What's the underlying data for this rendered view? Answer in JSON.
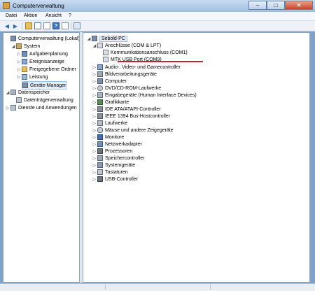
{
  "window": {
    "title": "Computerverwaltung",
    "controls": {
      "minimize": "–",
      "maximize": "□",
      "close": "✕"
    }
  },
  "menu": [
    "Datei",
    "Aktion",
    "Ansicht",
    "?"
  ],
  "left_tree": [
    {
      "label": "Computerverwaltung (Lokal)",
      "icon": "computer-management-icon"
    },
    {
      "label": "System",
      "icon": "system-tools-icon"
    },
    {
      "label": "Aufgabenplanung",
      "icon": "task-scheduler-icon"
    },
    {
      "label": "Ereignisanzeige",
      "icon": "event-viewer-icon"
    },
    {
      "label": "Freigegebene Ordner",
      "icon": "shared-folder-icon"
    },
    {
      "label": "Leistung",
      "icon": "performance-icon"
    },
    {
      "label": "Geräte-Manager",
      "icon": "device-manager-icon"
    },
    {
      "label": "Datenspeicher",
      "icon": "storage-icon"
    },
    {
      "label": "Datenträgerverwaltung",
      "icon": "disk-management-icon"
    },
    {
      "label": "Dienste und Anwendungen",
      "icon": "services-icon"
    }
  ],
  "device_tree": {
    "root": "Sebold-PC",
    "ports_group": "Anschlüsse (COM & LPT)",
    "ports": [
      "Kommunikationsanschluss (COM1)",
      "MTK USB Port (COM9)"
    ],
    "categories": [
      "Audio-, Video- und Gamecontroller",
      "Bildverarbeitungsgeräte",
      "Computer",
      "DVD/CD-ROM-Laufwerke",
      "Eingabegeräte (Human Interface Devices)",
      "Grafikkarte",
      "IDE ATA/ATAPI-Controller",
      "IEEE 1394 Bus-Hostcontroller",
      "Laufwerke",
      "Mäuse und andere Zeigegeräte",
      "Monitore",
      "Netzwerkadapter",
      "Prozessoren",
      "Speichercontroller",
      "Systemgeräte",
      "Tastaturen",
      "USB-Controller"
    ]
  },
  "colors": {
    "highlight": "#c0242a",
    "selection": "#e3eefb",
    "titlebar": "#9fbfe2"
  }
}
